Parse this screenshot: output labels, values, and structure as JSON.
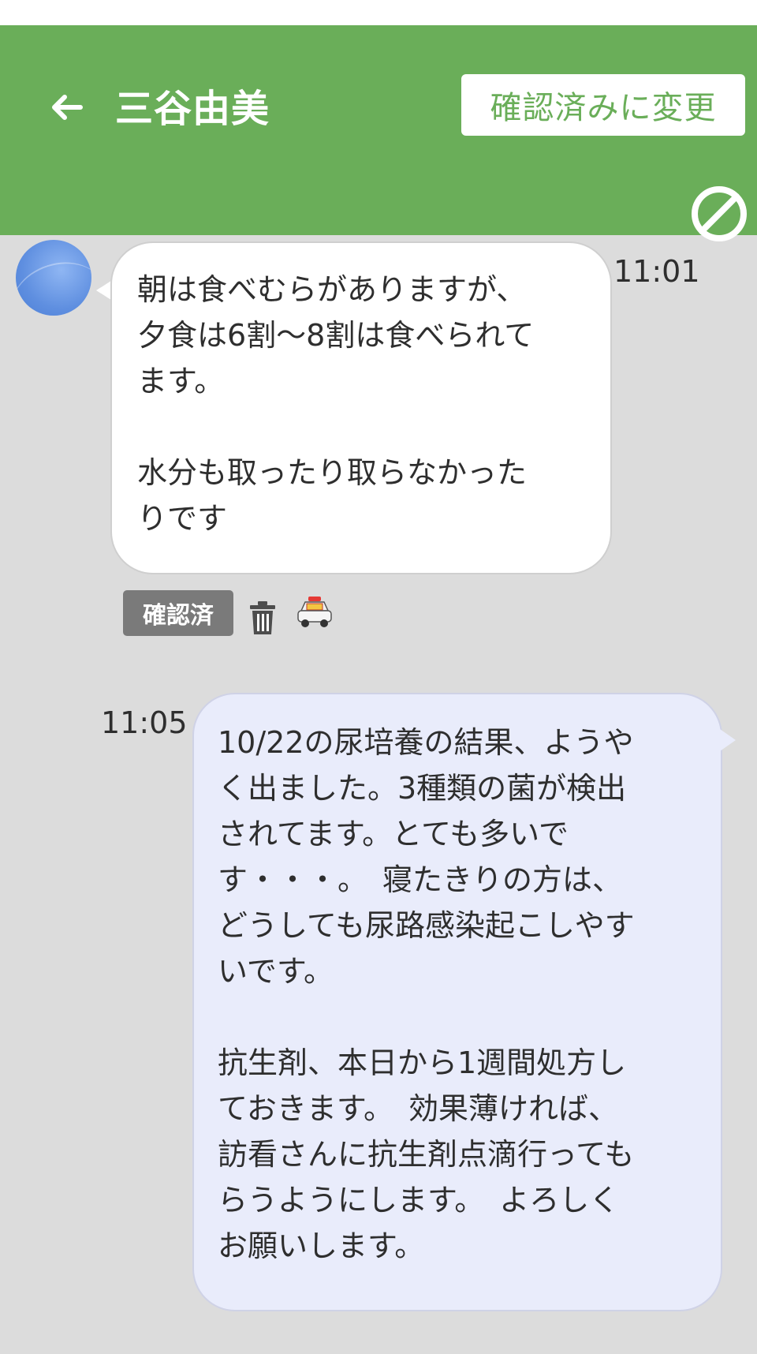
{
  "header": {
    "title": "三谷由美",
    "back_icon": "arrow-left-icon",
    "confirm_button_label": "確認済みに変更",
    "block_icon": "no-entry-icon",
    "color": "#6aae59"
  },
  "messages": [
    {
      "direction": "incoming",
      "time": "11:01",
      "text": "朝は食べむらがありますが、\n夕食は6割〜8割は食べられて\nます。\n\n水分も取ったり取らなかった\nりです",
      "badge": "確認済",
      "icons": [
        "trash-icon",
        "police-car-icon"
      ]
    },
    {
      "direction": "outgoing",
      "time": "11:05",
      "text": "10/22の尿培養の結果、ようや\nく出ました。3種類の菌が検出\nされてます。とても多いで\nす・・・。　寝たきりの方は、\nどうしても尿路感染起こしやす\nいです。\n\n抗生剤、本日から1週間処方し\nておきます。　効果薄ければ、\n訪看さんに抗生剤点滴行っても\nらうようにします。　よろしく\nお願いします。"
    }
  ]
}
